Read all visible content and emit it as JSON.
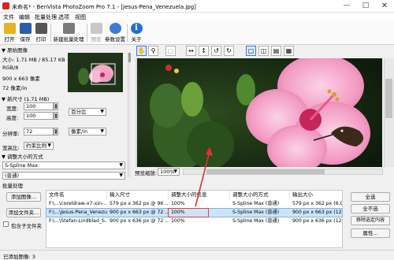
{
  "title_bar": {
    "text": "未命名* - BenVista PhotoZoom Pro 7.1 - [Jesus-Pena_Venezuela.jpg]"
  },
  "menu": [
    "文件",
    "编辑",
    "批量处理",
    "选项",
    "视图"
  ],
  "toolbar": [
    {
      "label": "打开",
      "icon": "open-folder-icon",
      "color": "#e6b422"
    },
    {
      "label": "保存",
      "icon": "save-disk-icon",
      "color": "#2a5db0"
    },
    {
      "label": "打印",
      "icon": "printer-icon",
      "color": "#555555"
    },
    {
      "label": "新建批量处理",
      "icon": "batch-stack-icon",
      "color": "#7a7a7a"
    },
    {
      "label": "预览",
      "icon": "preview-icon",
      "color": "#b8b8b8"
    },
    {
      "label": "参数设置",
      "icon": "settings-icon",
      "color": "#3a7bd5"
    },
    {
      "label": "关于",
      "icon": "info-icon",
      "color": "#1e6fd9"
    }
  ],
  "original_image": {
    "header": "▼ 原始图像",
    "size": "大小: 1.71 MB / 85.17 KB",
    "mode": "RGB/8",
    "dimensions": "900 x 663 像素",
    "resolution": "72 像素/in"
  },
  "new_size": {
    "header": "▼ 新尺寸 (1.71 MB)",
    "width_label": "宽度:",
    "width_value": "100",
    "height_label": "高度:",
    "height_value": "100",
    "unit": "百分比",
    "resolution_label": "分辨率:",
    "resolution_value": "72",
    "resolution_unit": "像素/in",
    "aspect_label": "宽高比:",
    "aspect_value": "约束比例"
  },
  "resize_method": {
    "header": "▼ 调整大小的方式",
    "value": "S-Spline Max",
    "preset": "(普通)"
  },
  "zoom": {
    "label": "预览缩放:",
    "value": "100%"
  },
  "batch": {
    "header": "批量处理",
    "add_image": "添加图像...",
    "add_folder": "添加文件夹...",
    "include_subfolders": "包含子文件夹",
    "select_all": "全选",
    "deselect_all": "全不选",
    "remove_selected": "移除选定内容",
    "properties": "属性...",
    "columns": [
      "文件名",
      "输入尺寸",
      "调整大小的信息",
      "调整大小的方式",
      "输出大小"
    ],
    "rows": [
      {
        "file": "F:\\...\\coreldraw-x7-xin-...",
        "input": "579 px x 362 px @ 96 ...",
        "info": "100%",
        "method": "S-Spline Max (普通)",
        "output": "579 px x 362 px (6.031...",
        "selected": false
      },
      {
        "file": "F:\\...\\Jesus-Pena_Venezuela.jpg",
        "input": "900 px x 663 px @ 72 ...",
        "info": "100%",
        "method": "S-Spline Max (普通)",
        "output": "900 px x 663 px (12.5\"...",
        "selected": true
      },
      {
        "file": "F:\\...\\Stefan-Lindblad_S...",
        "input": "900 px x 636 px @ 72 ...",
        "info": "100%",
        "method": "S-Spline Max (普通)",
        "output": "900 px x 636 px (12.5\"...",
        "selected": false
      }
    ]
  },
  "status": {
    "text": "已添加图像: 3"
  },
  "colors": {
    "accent_selected": "#cce4f7",
    "highlight_border": "#e04040"
  }
}
